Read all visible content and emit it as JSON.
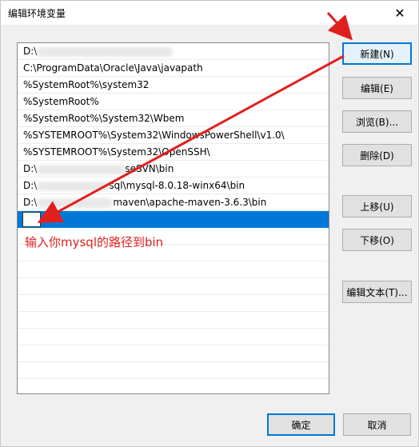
{
  "window": {
    "title": "编辑环境变量",
    "close_glyph": "✕"
  },
  "list": {
    "rows": [
      {
        "pre": "D:\\",
        "blur": 170,
        "post": ""
      },
      {
        "pre": "C:\\ProgramData\\Oracle\\Java\\javapath",
        "blur": 0,
        "post": ""
      },
      {
        "pre": "%SystemRoot%\\system32",
        "blur": 0,
        "post": ""
      },
      {
        "pre": "%SystemRoot%",
        "blur": 0,
        "post": ""
      },
      {
        "pre": "%SystemRoot%\\System32\\Wbem",
        "blur": 0,
        "post": ""
      },
      {
        "pre": "%SYSTEMROOT%\\System32\\WindowsPowerShell\\v1.0\\",
        "blur": 0,
        "post": ""
      },
      {
        "pre": "%SYSTEMROOT%\\System32\\OpenSSH\\",
        "blur": 0,
        "post": ""
      },
      {
        "pre": "D:\\",
        "blur": 110,
        "post": "seSVN\\bin"
      },
      {
        "pre": "D:\\",
        "blur": 90,
        "post": "sql\\mysql-8.0.18-winx64\\bin"
      },
      {
        "pre": "D:\\",
        "blur": 95,
        "post": "maven\\apache-maven-3.6.3\\bin"
      }
    ],
    "annotation": "输入你mysql的路径到bin"
  },
  "buttons": {
    "new": "新建(N)",
    "edit": "编辑(E)",
    "browse": "浏览(B)...",
    "delete": "删除(D)",
    "move_up": "上移(U)",
    "move_down": "下移(O)",
    "edit_text": "编辑文本(T)...",
    "ok": "确定",
    "cancel": "取消"
  },
  "colors": {
    "selection": "#0078d7",
    "annotation": "#e0201f"
  }
}
